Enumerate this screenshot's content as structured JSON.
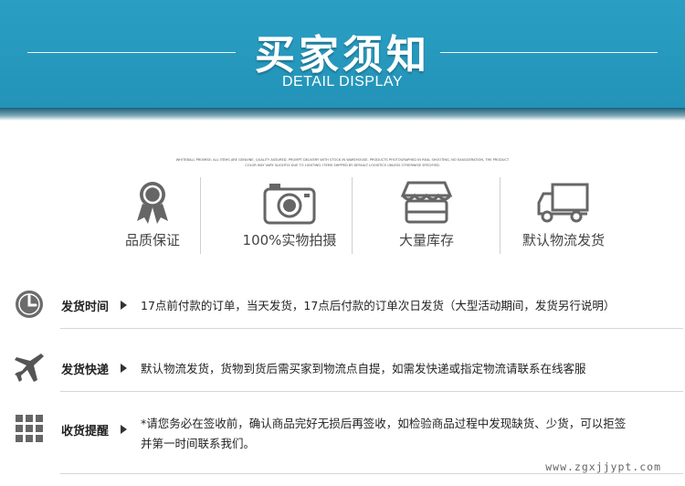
{
  "banner": {
    "title": "买家须知",
    "subtitle": "DETAIL DISPLAY"
  },
  "fine_print": "WHITEBALL PROMISE: ALL ITEMS ARE GENUINE, QUALITY ASSURED, PROMPT DELIVERY WITH STOCK IN WAREHOUSE. PRODUCTS PHOTOGRAPHED IN REAL SHOOTING, NO EXAGGERATION, THE PRODUCT COLOR MAY VARY SLIGHTLY DUE TO LIGHTING. ITEMS SHIPPED BY DEFAULT LOGISTICS UNLESS OTHERWISE SPECIFIED.",
  "features": [
    {
      "label": "品质保证",
      "icon": "award-ribbon-icon"
    },
    {
      "label": "100%实物拍摄",
      "icon": "camera-icon"
    },
    {
      "label": "大量库存",
      "icon": "store-icon"
    },
    {
      "label": "默认物流发货",
      "icon": "truck-icon"
    }
  ],
  "info": [
    {
      "label": "发货时间",
      "icon": "clock-icon",
      "text": "17点前付款的订单，当天发货，17点后付款的订单次日发货（大型活动期间，发货另行说明）"
    },
    {
      "label": "发货快递",
      "icon": "airplane-icon",
      "text": "默认物流发货，货物到货后需买家到物流点自提，如需发快递或指定物流请联系在线客服"
    },
    {
      "label": "收货提醒",
      "icon": "grid-icon",
      "text": "*请您务必在签收前，确认商品完好无损后再签收，如检验商品过程中发现缺货、少货，可以拒签并第一时间联系我们。"
    }
  ],
  "watermark": "www.zgxjjypt.com",
  "colors": {
    "banner": "#2a9fc3",
    "icon": "#666666"
  }
}
